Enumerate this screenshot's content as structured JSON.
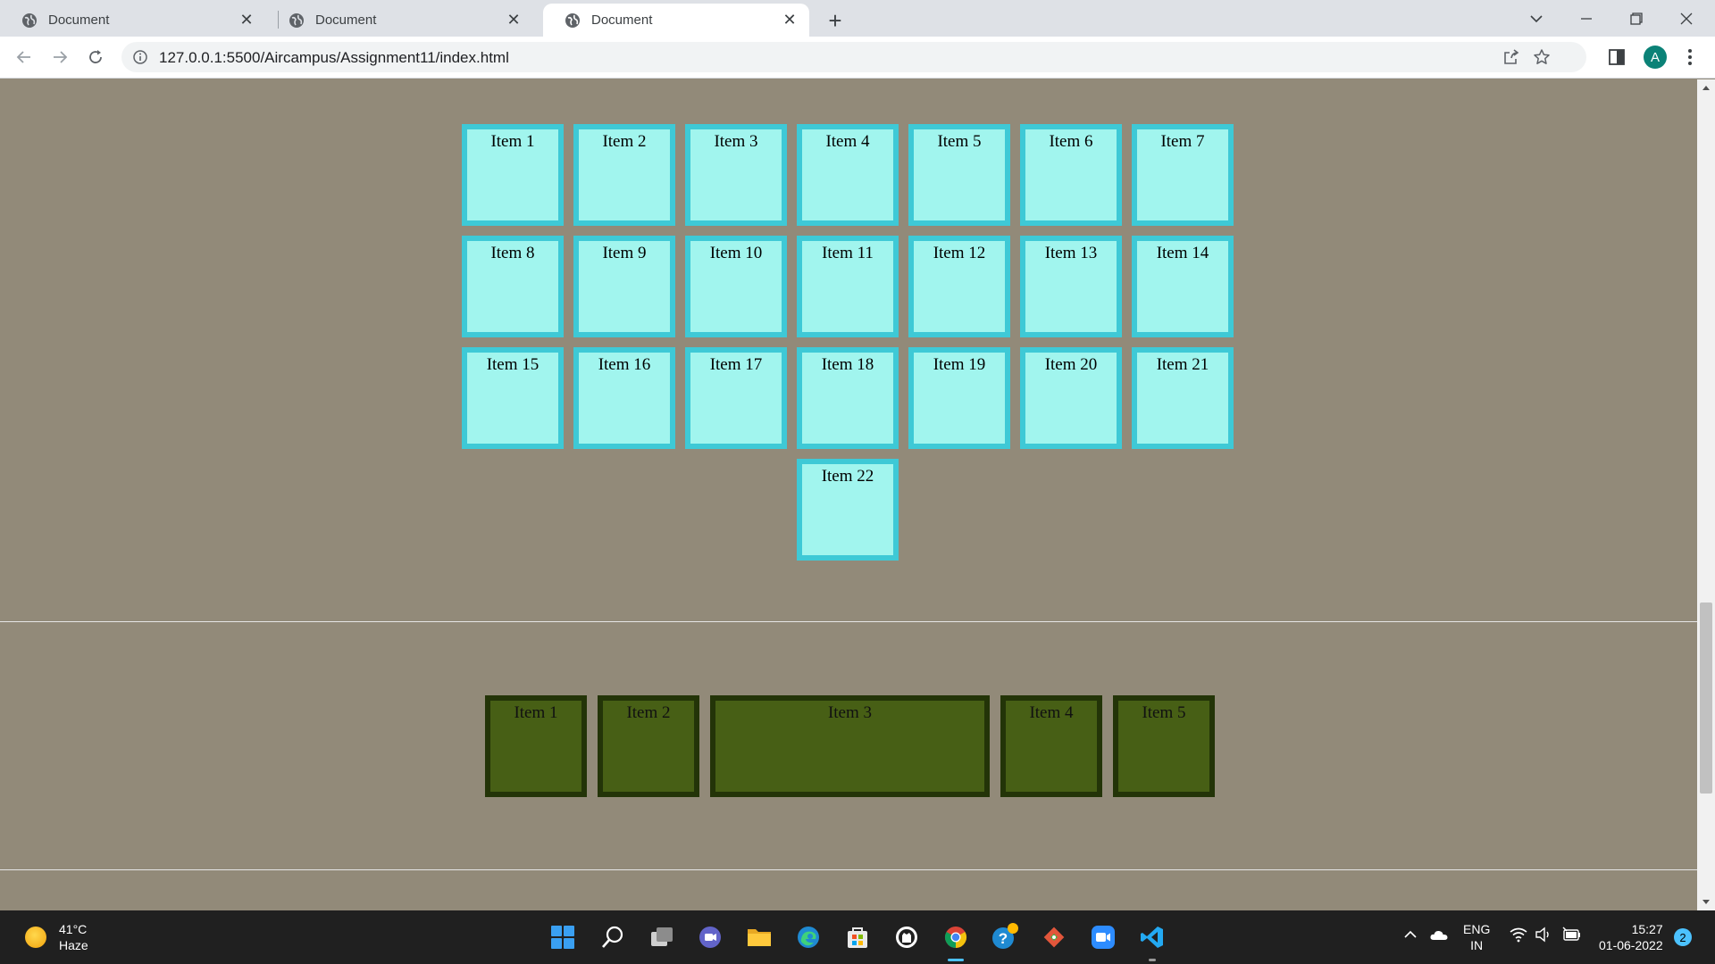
{
  "browser": {
    "tabs": [
      {
        "title": "Document",
        "active": false
      },
      {
        "title": "Document",
        "active": false
      },
      {
        "title": "Document",
        "active": true
      }
    ],
    "url": "127.0.0.1:5500/Aircampus/Assignment11/index.html",
    "profile_initial": "A"
  },
  "page": {
    "grid_items": [
      "Item 1",
      "Item 2",
      "Item 3",
      "Item 4",
      "Item 5",
      "Item 6",
      "Item 7",
      "Item 8",
      "Item 9",
      "Item 10",
      "Item 11",
      "Item 12",
      "Item 13",
      "Item 14",
      "Item 15",
      "Item 16",
      "Item 17",
      "Item 18",
      "Item 19",
      "Item 20",
      "Item 21",
      "Item 22"
    ],
    "flex_items": [
      "Item 1",
      "Item 2",
      "Item 3",
      "Item 4",
      "Item 5"
    ],
    "colors": {
      "background": "#928a79",
      "cyan_fill": "#a1f5ee",
      "cyan_border": "#3ec9d6",
      "green_fill": "#475f15",
      "green_border": "#233408"
    }
  },
  "taskbar": {
    "weather": {
      "temp": "41°C",
      "condition": "Haze"
    },
    "language": {
      "line1": "ENG",
      "line2": "IN"
    },
    "time": "15:27",
    "date": "01-06-2022",
    "notification_count": "2"
  }
}
